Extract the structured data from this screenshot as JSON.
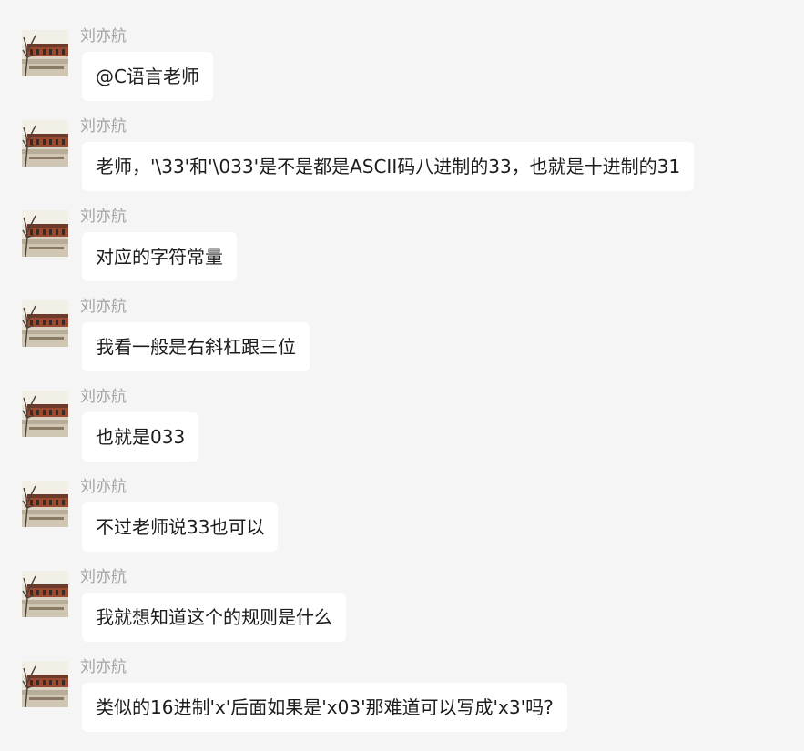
{
  "colors": {
    "background": "#f5f5f5",
    "bubble": "#ffffff",
    "sender_name": "#a3a3a3",
    "message_text": "#1c1c1c"
  },
  "messages": [
    {
      "sender": "刘亦航",
      "avatar": "avatar-photo",
      "text": "@C语言老师"
    },
    {
      "sender": "刘亦航",
      "avatar": "avatar-photo",
      "text": "老师，'\\33'和'\\033'是不是都是ASCII码八进制的33，也就是十进制的31"
    },
    {
      "sender": "刘亦航",
      "avatar": "avatar-photo",
      "text": "对应的字符常量"
    },
    {
      "sender": "刘亦航",
      "avatar": "avatar-photo",
      "text": "我看一般是右斜杠跟三位"
    },
    {
      "sender": "刘亦航",
      "avatar": "avatar-photo",
      "text": "也就是033"
    },
    {
      "sender": "刘亦航",
      "avatar": "avatar-photo",
      "text": "不过老师说33也可以"
    },
    {
      "sender": "刘亦航",
      "avatar": "avatar-photo",
      "text": "我就想知道这个的规则是什么"
    },
    {
      "sender": "刘亦航",
      "avatar": "avatar-photo",
      "text": "类似的16进制'x'后面如果是'x03'那难道可以写成'x3'吗?"
    }
  ]
}
